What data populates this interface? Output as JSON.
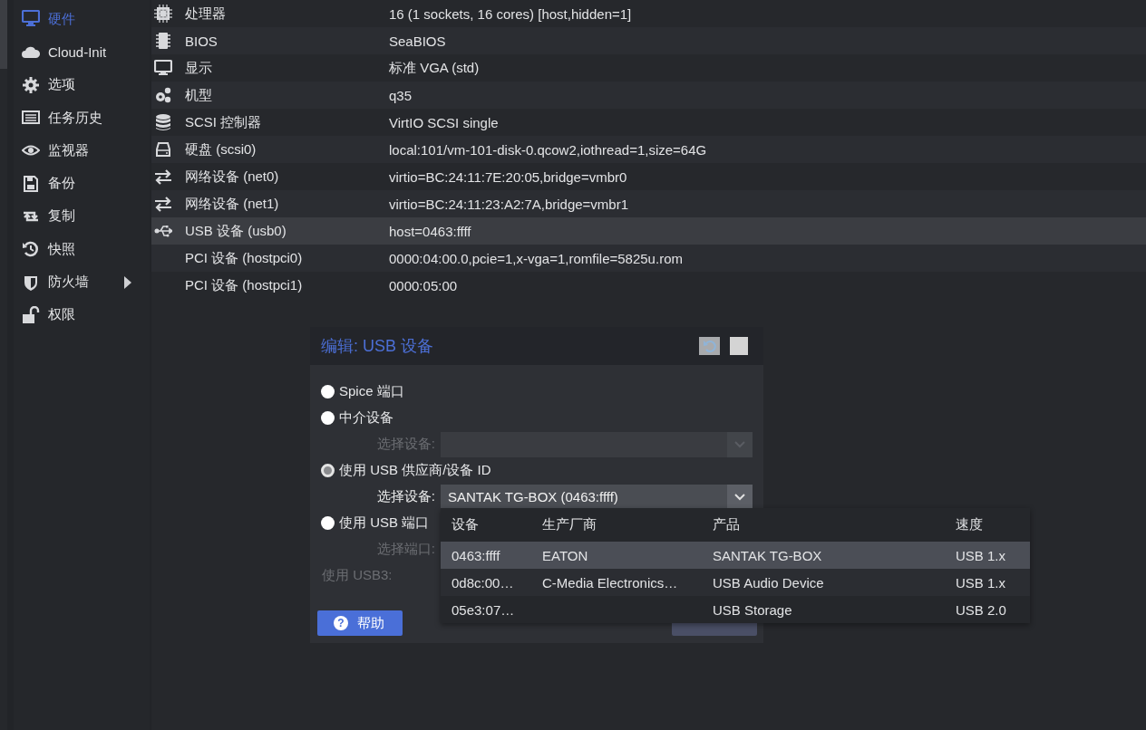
{
  "sidebar": {
    "items": [
      {
        "label": "硬件",
        "selected": true,
        "submenu": false
      },
      {
        "label": "Cloud-Init",
        "selected": false,
        "submenu": false
      },
      {
        "label": "选项",
        "selected": false,
        "submenu": false
      },
      {
        "label": "任务历史",
        "selected": false,
        "submenu": false
      },
      {
        "label": "监视器",
        "selected": false,
        "submenu": false
      },
      {
        "label": "备份",
        "selected": false,
        "submenu": false
      },
      {
        "label": "复制",
        "selected": false,
        "submenu": false
      },
      {
        "label": "快照",
        "selected": false,
        "submenu": false
      },
      {
        "label": "防火墙",
        "selected": false,
        "submenu": true
      },
      {
        "label": "权限",
        "selected": false,
        "submenu": false
      }
    ]
  },
  "hardware": {
    "rows": [
      {
        "name": "处理器",
        "value": "16 (1 sockets, 16 cores) [host,hidden=1]",
        "selected": false
      },
      {
        "name": "BIOS",
        "value": "SeaBIOS",
        "selected": false
      },
      {
        "name": "显示",
        "value": "标准 VGA (std)",
        "selected": false
      },
      {
        "name": "机型",
        "value": "q35",
        "selected": false
      },
      {
        "name": "SCSI 控制器",
        "value": "VirtIO SCSI single",
        "selected": false
      },
      {
        "name": "硬盘 (scsi0)",
        "value": "local:101/vm-101-disk-0.qcow2,iothread=1,size=64G",
        "selected": false
      },
      {
        "name": "网络设备 (net0)",
        "value": "virtio=BC:24:11:7E:20:05,bridge=vmbr0",
        "selected": false
      },
      {
        "name": "网络设备 (net1)",
        "value": "virtio=BC:24:11:23:A2:7A,bridge=vmbr1",
        "selected": false
      },
      {
        "name": "USB 设备 (usb0)",
        "value": "host=0463:ffff",
        "selected": true
      },
      {
        "name": "PCI 设备 (hostpci0)",
        "value": "0000:04:00.0,pcie=1,x-vga=1,romfile=5825u.rom",
        "selected": false
      },
      {
        "name": "PCI 设备 (hostpci1)",
        "value": "0000:05:00",
        "selected": false
      }
    ]
  },
  "dialog": {
    "title": "编辑: USB 设备",
    "fields": [
      {
        "kind": "radio",
        "label": "Spice 端口",
        "selected": false
      },
      {
        "kind": "radio",
        "label": "中介设备",
        "selected": false
      },
      {
        "kind": "select",
        "label": "选择设备:",
        "disabled": true
      },
      {
        "kind": "radio",
        "label": "使用 USB 供应商/设备 ID",
        "selected": true
      },
      {
        "kind": "select",
        "label": "选择设备:",
        "value": "SANTAK TG-BOX (0463:ffff)",
        "disabled": false
      },
      {
        "kind": "radio",
        "label": "使用 USB 端口",
        "selected": false
      },
      {
        "kind": "select",
        "label": "选择端口:",
        "disabled": true
      },
      {
        "kind": "label",
        "label": "使用 USB3:",
        "disabled": true
      }
    ],
    "buttons": [
      {
        "icon": "?",
        "label": "帮助",
        "kind": "help",
        "disabled": false
      },
      {
        "kind": "ok",
        "disabled": true
      }
    ],
    "dropdown": {
      "columns": [
        "设备",
        "生产厂商",
        "产品",
        "速度"
      ],
      "rows": [
        {
          "cells": [
            "0463:ffff",
            "EATON",
            "SANTAK TG-BOX",
            "USB 1.x"
          ],
          "selected": true
        },
        {
          "cells": [
            "0d8c:00…",
            "C-Media Electronics…",
            "USB Audio Device",
            "USB 1.x"
          ],
          "selected": false
        },
        {
          "cells": [
            "05e3:07…",
            "",
            "USB Storage",
            "USB 2.0"
          ],
          "selected": false
        }
      ]
    }
  }
}
